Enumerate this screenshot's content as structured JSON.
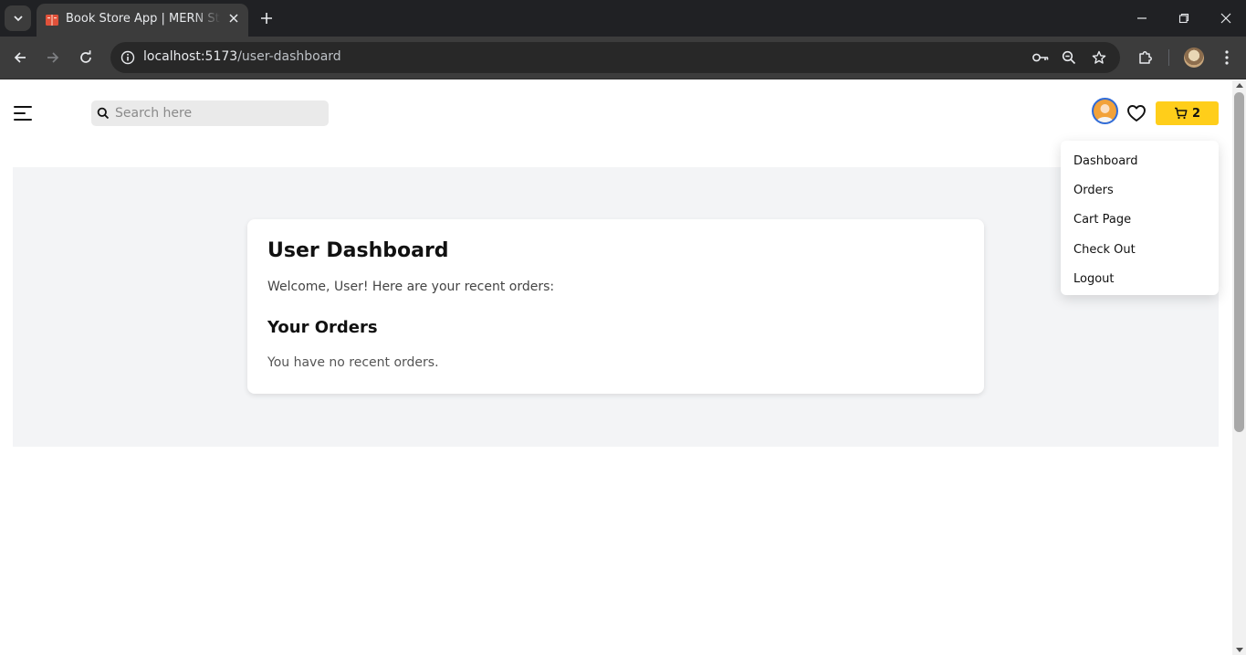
{
  "browser": {
    "tab_title": "Book Store App | MERN Stack Project",
    "url_host": "localhost:5173",
    "url_path": "/user-dashboard",
    "icons": {
      "tab_list": "chevron-down-icon",
      "favicon": "book-favicon",
      "tab_close": "close-icon",
      "new_tab": "plus-icon",
      "minimize": "minimize-icon",
      "restore": "restore-icon",
      "close_window": "close-icon",
      "back": "arrow-left-icon",
      "forward": "arrow-right-icon",
      "reload": "reload-icon",
      "site_info": "info-icon",
      "password": "key-icon",
      "zoom": "zoom-icon",
      "bookmark": "star-icon",
      "extensions": "puzzle-icon",
      "menu": "more-vertical-icon"
    }
  },
  "header": {
    "search_placeholder": "Search here",
    "cart_count": "2",
    "icons": {
      "menu": "hamburger-icon",
      "search": "search-icon",
      "wishlist": "heart-icon",
      "cart": "cart-icon"
    }
  },
  "user_menu": {
    "items": [
      "Dashboard",
      "Orders",
      "Cart Page",
      "Check Out",
      "Logout"
    ]
  },
  "dashboard": {
    "title": "User Dashboard",
    "welcome": "Welcome, User! Here are your recent orders:",
    "orders_title": "Your Orders",
    "empty_message": "You have no recent orders."
  },
  "colors": {
    "accent": "#ffce1a",
    "avatar_ring": "#2f6bd8",
    "section_bg": "#f3f4f6"
  }
}
